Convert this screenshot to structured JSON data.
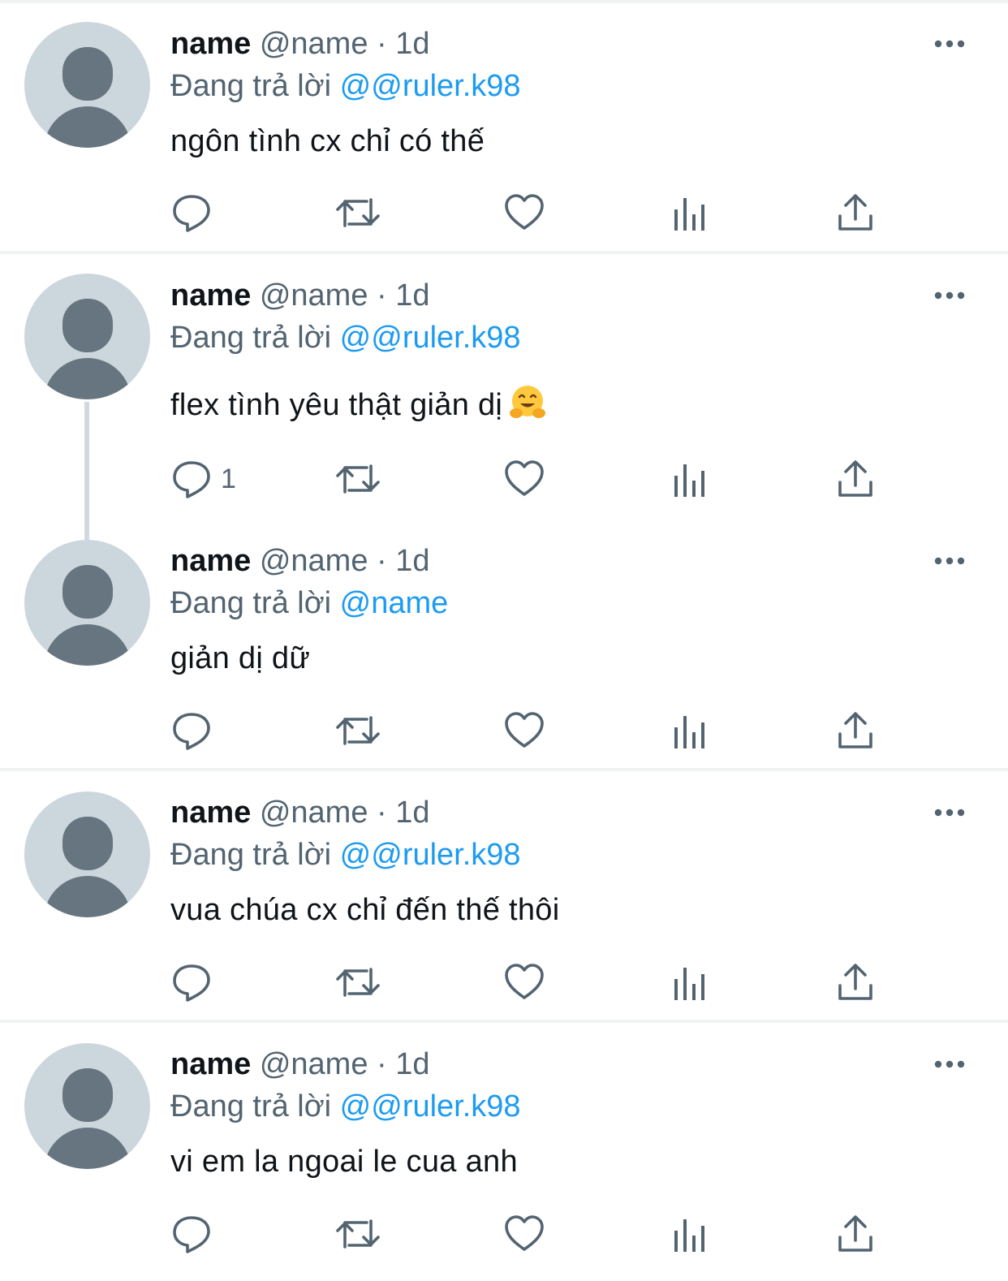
{
  "tweets": [
    {
      "name": "name",
      "handle": "@name",
      "separator": "·",
      "time": "1d",
      "reply_prefix": "Đang trả lời",
      "reply_to": "@@ruler.k98",
      "text": "ngôn tình cx chỉ có thế",
      "reply_count": ""
    },
    {
      "name": "name",
      "handle": "@name",
      "separator": "·",
      "time": "1d",
      "reply_prefix": "Đang trả lời",
      "reply_to": "@@ruler.k98",
      "text": "flex tình yêu thật giản dị",
      "emoji": "hugging-face-emoji",
      "reply_count": "1"
    },
    {
      "name": "name",
      "handle": "@name",
      "separator": "·",
      "time": "1d",
      "reply_prefix": "Đang trả lời",
      "reply_to": "@name",
      "text": "giản dị dữ",
      "reply_count": ""
    },
    {
      "name": "name",
      "handle": "@name",
      "separator": "·",
      "time": "1d",
      "reply_prefix": "Đang trả lời",
      "reply_to": "@@ruler.k98",
      "text": "vua chúa cx chỉ đến thế thôi",
      "reply_count": ""
    },
    {
      "name": "name",
      "handle": "@name",
      "separator": "·",
      "time": "1d",
      "reply_prefix": "Đang trả lời",
      "reply_to": "@@ruler.k98",
      "text": "vi em la ngoai le cua anh",
      "reply_count": ""
    }
  ],
  "icons": {
    "reply": "reply-bubble-icon",
    "retweet": "retweet-icon",
    "like": "heart-icon",
    "views": "analytics-bars-icon",
    "share": "share-upload-icon",
    "more": "more-dots-icon"
  },
  "colors": {
    "icon": "#536471",
    "link": "#1d9bf0",
    "avatar_bg": "#ccd6dd",
    "avatar_fg": "#66757f",
    "divider": "#eff3f4",
    "thread_line": "#cfd9de"
  }
}
